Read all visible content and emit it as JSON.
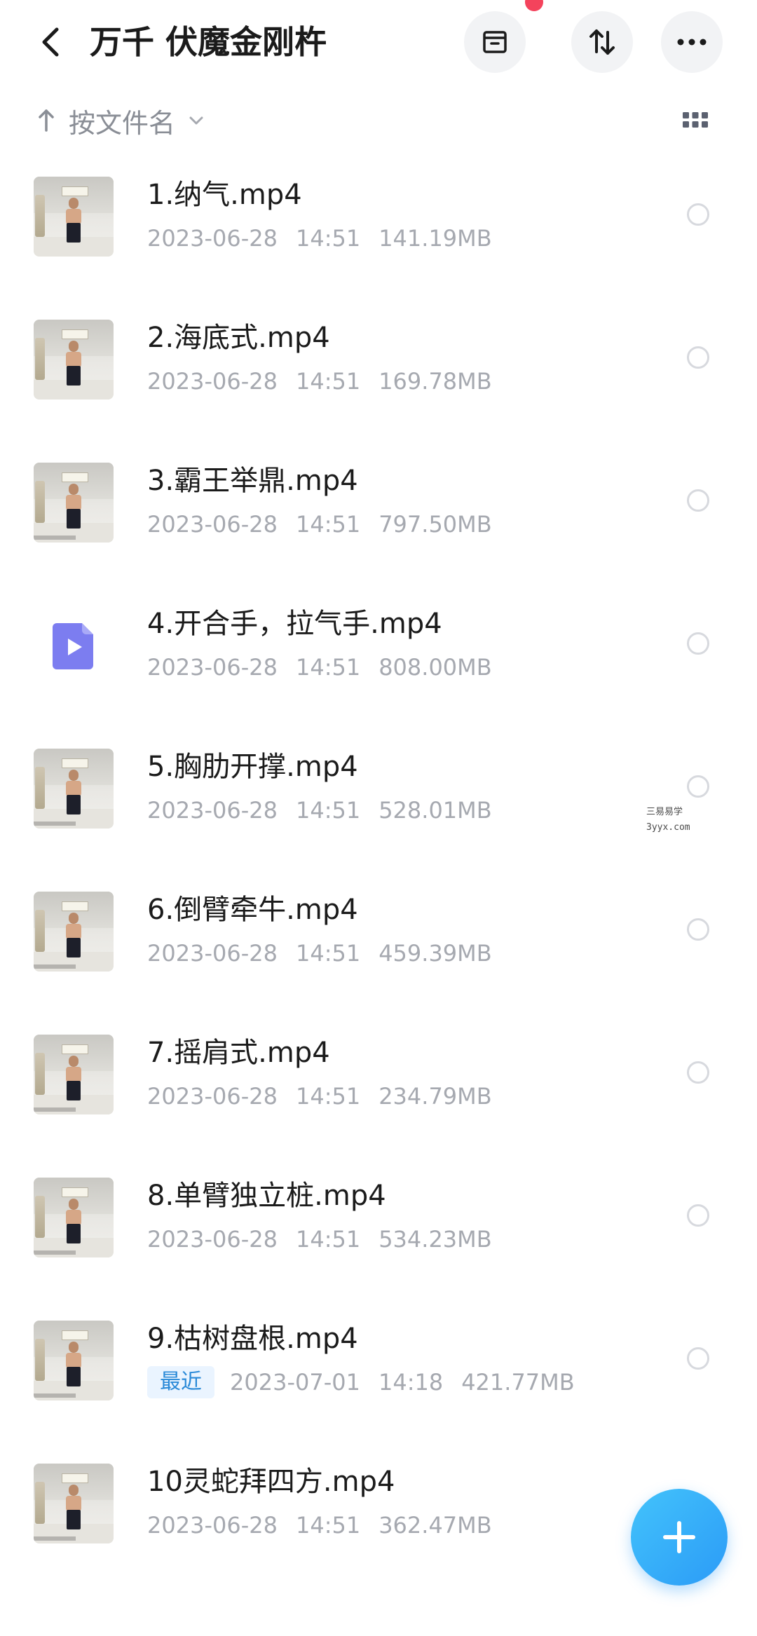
{
  "header": {
    "title": "万千 伏魔金刚杵"
  },
  "icons": {
    "back": "chevron-left-icon",
    "archive": "archive-box-icon",
    "sort_toggle": "swap-vertical-icon",
    "more": "more-horizontal-icon",
    "grid_view": "grid-view-icon",
    "add": "plus-icon"
  },
  "colors": {
    "accent": "#2b9bf7",
    "notification": "#f4435c",
    "recent_badge_text": "#2a8ad8"
  },
  "sortbar": {
    "label": "按文件名"
  },
  "files": [
    {
      "name": "1.纳气.mp4",
      "date": "2023-06-28",
      "time": "14:51",
      "size": "141.19MB",
      "badge": ""
    },
    {
      "name": "2.海底式.mp4",
      "date": "2023-06-28",
      "time": "14:51",
      "size": "169.78MB",
      "badge": ""
    },
    {
      "name": "3.霸王举鼎.mp4",
      "date": "2023-06-28",
      "time": "14:51",
      "size": "797.50MB",
      "badge": ""
    },
    {
      "name": "4.开合手，拉气手.mp4",
      "date": "2023-06-28",
      "time": "14:51",
      "size": "808.00MB",
      "badge": ""
    },
    {
      "name": "5.胸肋开撑.mp4",
      "date": "2023-06-28",
      "time": "14:51",
      "size": "528.01MB",
      "badge": ""
    },
    {
      "name": "6.倒臂牵牛.mp4",
      "date": "2023-06-28",
      "time": "14:51",
      "size": "459.39MB",
      "badge": ""
    },
    {
      "name": "7.摇肩式.mp4",
      "date": "2023-06-28",
      "time": "14:51",
      "size": "234.79MB",
      "badge": ""
    },
    {
      "name": "8.单臂独立桩.mp4",
      "date": "2023-06-28",
      "time": "14:51",
      "size": "534.23MB",
      "badge": ""
    },
    {
      "name": "9.枯树盘根.mp4",
      "date": "2023-07-01",
      "time": "14:18",
      "size": "421.77MB",
      "badge": "最近"
    },
    {
      "name": "10灵蛇拜四方.mp4",
      "date": "2023-06-28",
      "time": "14:51",
      "size": "362.47MB",
      "badge": ""
    }
  ],
  "watermark": {
    "line1": "三易易学",
    "line2": "3yyx.com"
  }
}
